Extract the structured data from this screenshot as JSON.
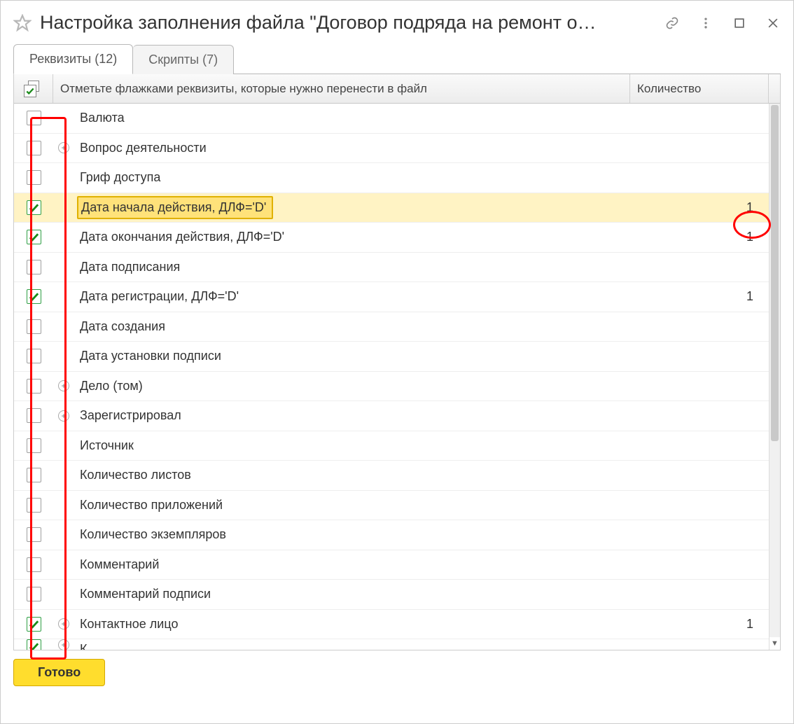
{
  "title": "Настройка заполнения файла \"Договор подряда на ремонт о…",
  "tabs": [
    {
      "label": "Реквизиты (12)",
      "active": true
    },
    {
      "label": "Скрипты (7)",
      "active": false
    }
  ],
  "header": {
    "instructions": "Отметьте флажками реквизиты, которые нужно перенести в файл",
    "count_label": "Количество"
  },
  "rows": [
    {
      "checked": false,
      "expandable": false,
      "label": "Валюта",
      "count": ""
    },
    {
      "checked": false,
      "expandable": true,
      "label": "Вопрос деятельности",
      "count": ""
    },
    {
      "checked": false,
      "expandable": false,
      "label": "Гриф доступа",
      "count": ""
    },
    {
      "checked": true,
      "expandable": false,
      "label": "Дата начала действия, ДЛФ='D'",
      "count": "1",
      "selected": true
    },
    {
      "checked": true,
      "expandable": false,
      "label": "Дата окончания действия, ДЛФ='D'",
      "count": "1"
    },
    {
      "checked": false,
      "expandable": false,
      "label": "Дата подписания",
      "count": ""
    },
    {
      "checked": true,
      "expandable": false,
      "label": "Дата регистрации, ДЛФ='D'",
      "count": "1"
    },
    {
      "checked": false,
      "expandable": false,
      "label": "Дата создания",
      "count": ""
    },
    {
      "checked": false,
      "expandable": false,
      "label": "Дата установки подписи",
      "count": ""
    },
    {
      "checked": false,
      "expandable": true,
      "label": "Дело (том)",
      "count": ""
    },
    {
      "checked": false,
      "expandable": true,
      "label": "Зарегистрировал",
      "count": ""
    },
    {
      "checked": false,
      "expandable": false,
      "label": "Источник",
      "count": ""
    },
    {
      "checked": false,
      "expandable": false,
      "label": "Количество листов",
      "count": ""
    },
    {
      "checked": false,
      "expandable": false,
      "label": "Количество приложений",
      "count": ""
    },
    {
      "checked": false,
      "expandable": false,
      "label": "Количество экземпляров",
      "count": ""
    },
    {
      "checked": false,
      "expandable": false,
      "label": "Комментарий",
      "count": ""
    },
    {
      "checked": false,
      "expandable": false,
      "label": "Комментарий подписи",
      "count": ""
    },
    {
      "checked": true,
      "expandable": true,
      "label": "Контактное лицо",
      "count": "1"
    },
    {
      "checked": true,
      "expandable": true,
      "label": "К",
      "count": "",
      "partial": true
    }
  ],
  "footer": {
    "ready": "Готово"
  }
}
